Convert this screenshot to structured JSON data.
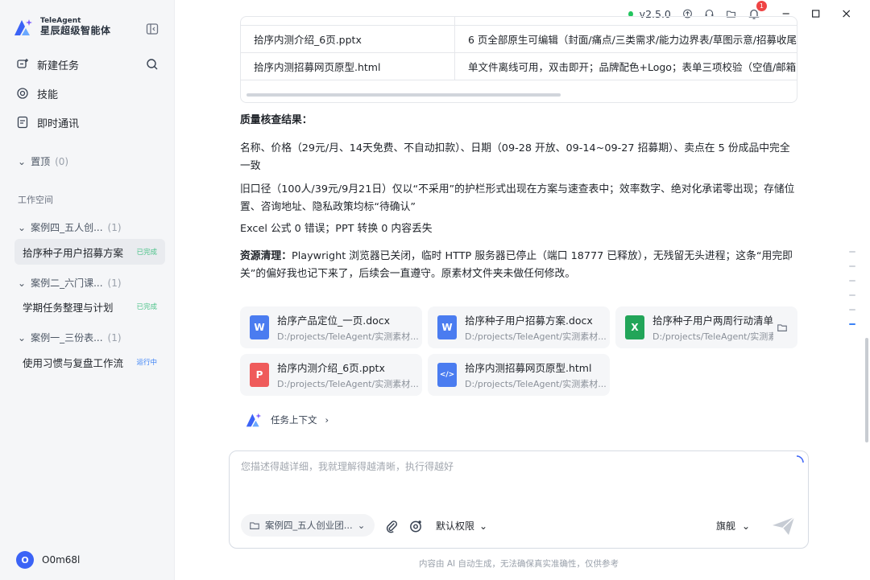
{
  "brand": {
    "en": "TeleAgent",
    "cn": "星辰超级智能体"
  },
  "nav": {
    "new_task": "新建任务",
    "skills": "技能",
    "im": "即时通讯"
  },
  "sidebar": {
    "pinned": {
      "label": "置顶",
      "count": "(0)"
    },
    "workspace_label": "工作空间",
    "groups": [
      {
        "label": "案例四_五人创...",
        "count": "(1)",
        "task": "拾序种子用户招募方案",
        "status": "已完成"
      },
      {
        "label": "案例二_六门课...",
        "count": "(1)",
        "task": "学期任务整理与计划",
        "status": "已完成"
      },
      {
        "label": "案例一_三份表...",
        "count": "(1)",
        "task": "使用习惯与复盘工作流",
        "status": "运行中"
      }
    ],
    "user": {
      "initial": "O",
      "name": "O0m68l"
    }
  },
  "topbar": {
    "version": "v2.5.0",
    "notif_count": "1",
    "accent": "#3b63f6"
  },
  "table": {
    "rows": [
      {
        "file": "拾序内测介绍_6页.pptx",
        "desc": "6 页全部原生可编辑（封面/痛点/三类需求/能力边界表/草图示意/招募收尾"
      },
      {
        "file": "拾序内测招募网页原型.html",
        "desc": "单文件离线可用，双击即开；品牌配色+Logo；表单三项校验（空值/邮箱"
      }
    ]
  },
  "content": {
    "qc_title": "质量核查结果：",
    "p1": "名称、价格（29元/月、14天免费、不自动扣款）、日期（09-28 开放、09-14~09-27 招募期）、卖点在 5 份成品中完全一致",
    "p2": "旧口径（100人/39元/9月21日）仅以“不采用”的护栏形式出现在方案与速查表中；效率数字、绝对化承诺零出现；存储位置、咨询地址、隐私政策均标“待确认”",
    "p3": "Excel 公式 0 错误；PPT 转换 0 内容丢失",
    "cleanup_title": "资源清理：",
    "p4": "Playwright 浏览器已关闭，临时 HTTP 服务器已停止（端口 18777 已释放），无残留无头进程；这条“用完即关”的偏好我也记下来了，后续会一直遵守。原素材文件夹未做任何修改。"
  },
  "files": [
    {
      "name": "拾序产品定位_一页.docx",
      "path": "D:/projects/TeleAgent/实测素材...",
      "icon": "W",
      "color": "#4a7cf0"
    },
    {
      "name": "拾序种子用户招募方案.docx",
      "path": "D:/projects/TeleAgent/实测素材...",
      "icon": "W",
      "color": "#4a7cf0"
    },
    {
      "name": "拾序种子用户两周行动清单",
      "path": "D:/projects/TeleAgent/实测素",
      "icon": "X",
      "color": "#22a559"
    },
    {
      "name": "拾序内测介绍_6页.pptx",
      "path": "D:/projects/TeleAgent/实测素材...",
      "icon": "P",
      "color": "#ef5b5b"
    },
    {
      "name": "拾序内测招募网页原型.html",
      "path": "D:/projects/TeleAgent/实测素材...",
      "icon": "</>",
      "color": "#4a7cf0"
    }
  ],
  "context_link": "任务上下文",
  "composer": {
    "placeholder": "您描述得越详细，我就理解得越清晰，执行得越好",
    "folder": "案例四_五人创业团...",
    "permission": "默认权限",
    "model": "旗舰"
  },
  "disclaimer": "内容由 AI 自动生成，无法确保真实准确性，仅供参考"
}
